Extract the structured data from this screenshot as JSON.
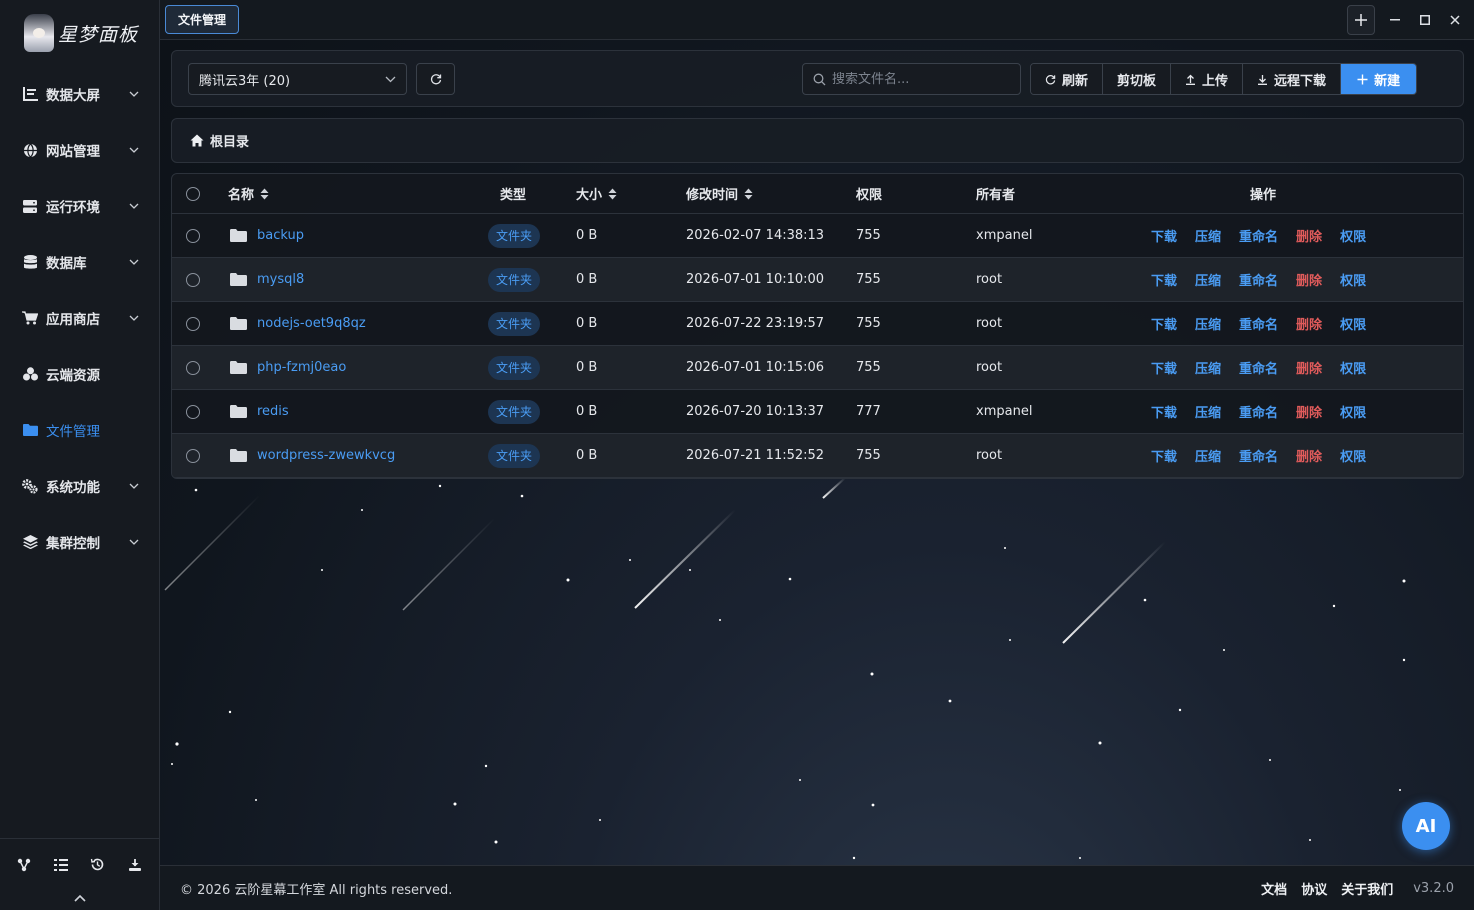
{
  "app": {
    "logo_text": "星梦面板",
    "version": "v3.2.0",
    "accent": "#3b8ff0",
    "danger": "#e05b5b"
  },
  "topbar": {
    "active_tab": "文件管理"
  },
  "sidebar": {
    "items": [
      {
        "label": "数据大屏",
        "icon": "dashboard-icon",
        "expandable": true
      },
      {
        "label": "网站管理",
        "icon": "globe-icon",
        "expandable": true
      },
      {
        "label": "运行环境",
        "icon": "server-icon",
        "expandable": true
      },
      {
        "label": "数据库",
        "icon": "database-icon",
        "expandable": true
      },
      {
        "label": "应用商店",
        "icon": "cart-icon",
        "expandable": true
      },
      {
        "label": "云端资源",
        "icon": "cloud-resource-icon",
        "expandable": false
      },
      {
        "label": "文件管理",
        "icon": "folder-icon",
        "expandable": false,
        "active": true
      },
      {
        "label": "系统功能",
        "icon": "gears-icon",
        "expandable": true
      },
      {
        "label": "集群控制",
        "icon": "layers-icon",
        "expandable": true
      }
    ],
    "bottom_icons": [
      "share-icon",
      "list-icon",
      "history-icon",
      "download-icon"
    ]
  },
  "toolbar": {
    "server_select": "腾讯云3年 (20)",
    "search_placeholder": "搜索文件名...",
    "refresh_label": "刷新",
    "clipboard_label": "剪切板",
    "upload_label": "上传",
    "remote_download_label": "远程下载",
    "new_label": "新建"
  },
  "breadcrumb": {
    "root_label": "根目录"
  },
  "table": {
    "headers": {
      "name": "名称",
      "type": "类型",
      "size": "大小",
      "mtime": "修改时间",
      "perm": "权限",
      "owner": "所有者",
      "actions": "操作"
    },
    "action_labels": {
      "download": "下载",
      "compress": "压缩",
      "rename": "重命名",
      "delete": "删除",
      "permission": "权限"
    },
    "rows": [
      {
        "name": "backup",
        "type": "文件夹",
        "size": "0 B",
        "mtime": "2026-02-07 14:38:13",
        "perm": "755",
        "owner": "xmpanel"
      },
      {
        "name": "mysql8",
        "type": "文件夹",
        "size": "0 B",
        "mtime": "2026-07-01 10:10:00",
        "perm": "755",
        "owner": "root"
      },
      {
        "name": "nodejs-oet9q8qz",
        "type": "文件夹",
        "size": "0 B",
        "mtime": "2026-07-22 23:19:57",
        "perm": "755",
        "owner": "root"
      },
      {
        "name": "php-fzmj0eao",
        "type": "文件夹",
        "size": "0 B",
        "mtime": "2026-07-01 10:15:06",
        "perm": "755",
        "owner": "root"
      },
      {
        "name": "redis",
        "type": "文件夹",
        "size": "0 B",
        "mtime": "2026-07-20 10:13:37",
        "perm": "777",
        "owner": "xmpanel"
      },
      {
        "name": "wordpress-zwewkvcg",
        "type": "文件夹",
        "size": "0 B",
        "mtime": "2026-07-21 11:52:52",
        "perm": "755",
        "owner": "root"
      }
    ]
  },
  "footer": {
    "copyright": "© 2026 云阶星幕工作室 All rights reserved.",
    "docs": "文档",
    "agreement": "协议",
    "about": "关于我们"
  },
  "ai_button": "AI"
}
